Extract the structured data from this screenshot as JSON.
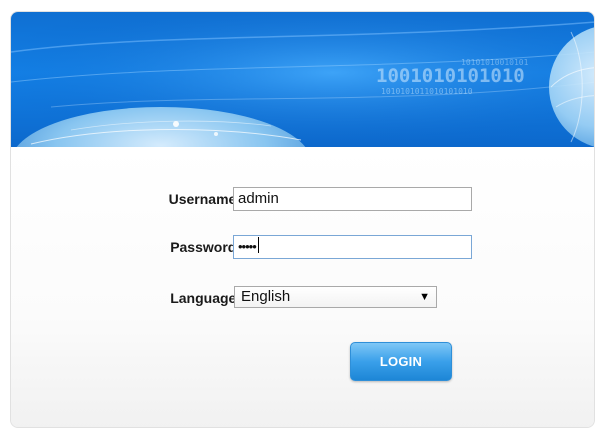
{
  "login_form": {
    "username_label": "Username:",
    "username_value": "admin",
    "password_label": "Password:",
    "password_value": "•••••",
    "language_label": "Language:",
    "language_selected": "English",
    "login_button": "LOGIN"
  },
  "banner": {
    "binary_text": "1001010101010",
    "binary_text_small": "1010101011010101010"
  },
  "colors": {
    "banner_blue": "#1380e6",
    "button_blue": "#3aa0ea",
    "background": "#f5f5f5"
  },
  "icons": {
    "dropdown": "chevron-down-icon",
    "banner_art": "globe-icon"
  }
}
